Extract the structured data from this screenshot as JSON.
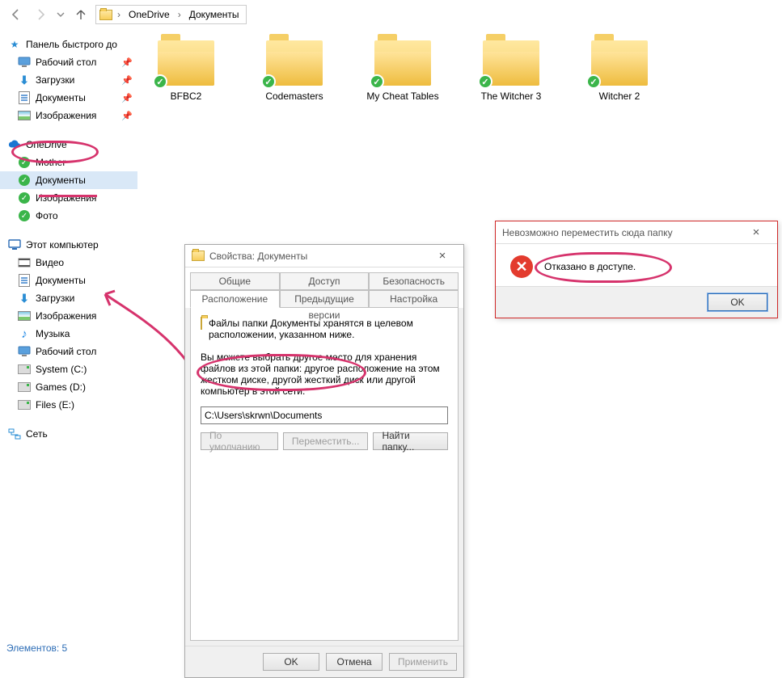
{
  "breadcrumb": {
    "root": "OneDrive",
    "current": "Документы"
  },
  "sidebar": {
    "quick_access": "Панель быстрого до",
    "quick_items": [
      {
        "label": "Рабочий стол",
        "pin": true,
        "icon": "desktop"
      },
      {
        "label": "Загрузки",
        "pin": true,
        "icon": "download"
      },
      {
        "label": "Документы",
        "pin": true,
        "icon": "doc"
      },
      {
        "label": "Изображения",
        "pin": true,
        "icon": "img"
      }
    ],
    "onedrive": "OneDrive",
    "onedrive_items": [
      {
        "label": "Mother"
      },
      {
        "label": "Документы",
        "selected": true
      },
      {
        "label": "Изображения"
      },
      {
        "label": "Фото"
      }
    ],
    "thispc": "Этот компьютер",
    "thispc_items": [
      {
        "label": "Видео",
        "icon": "video"
      },
      {
        "label": "Документы",
        "icon": "doc"
      },
      {
        "label": "Загрузки",
        "icon": "download"
      },
      {
        "label": "Изображения",
        "icon": "img"
      },
      {
        "label": "Музыка",
        "icon": "music"
      },
      {
        "label": "Рабочий стол",
        "icon": "desktop"
      },
      {
        "label": "System (C:)",
        "icon": "disk"
      },
      {
        "label": "Games (D:)",
        "icon": "disk"
      },
      {
        "label": "Files (E:)",
        "icon": "disk"
      }
    ],
    "network": "Сеть"
  },
  "folders": [
    {
      "name": "BFBC2"
    },
    {
      "name": "Codemasters"
    },
    {
      "name": "My Cheat Tables"
    },
    {
      "name": "The Witcher 3"
    },
    {
      "name": "Witcher 2"
    }
  ],
  "statusbar": {
    "text": "Элементов: 5"
  },
  "props_dialog": {
    "title": "Свойства: Документы",
    "tabs_row1": [
      "Общие",
      "Доступ",
      "Безопасность"
    ],
    "tabs_row2": [
      "Расположение",
      "Предыдущие версии",
      "Настройка"
    ],
    "active_tab": "Расположение",
    "line1": "Файлы папки Документы хранятся в целевом расположении, указанном ниже.",
    "line2": "Вы можете выбрать другое место для хранения файлов из этой папки: другое расположение на этом жестком диске, другой жесткий диск или другой компьютер в этой сети.",
    "path": "C:\\Users\\skrwn\\Documents",
    "btn_default": "По умолчанию",
    "btn_move": "Переместить...",
    "btn_find": "Найти папку...",
    "btn_ok": "OK",
    "btn_cancel": "Отмена",
    "btn_apply": "Применить"
  },
  "error_dialog": {
    "title": "Невозможно переместить сюда папку",
    "message": "Отказано в доступе.",
    "btn_ok": "OK"
  }
}
